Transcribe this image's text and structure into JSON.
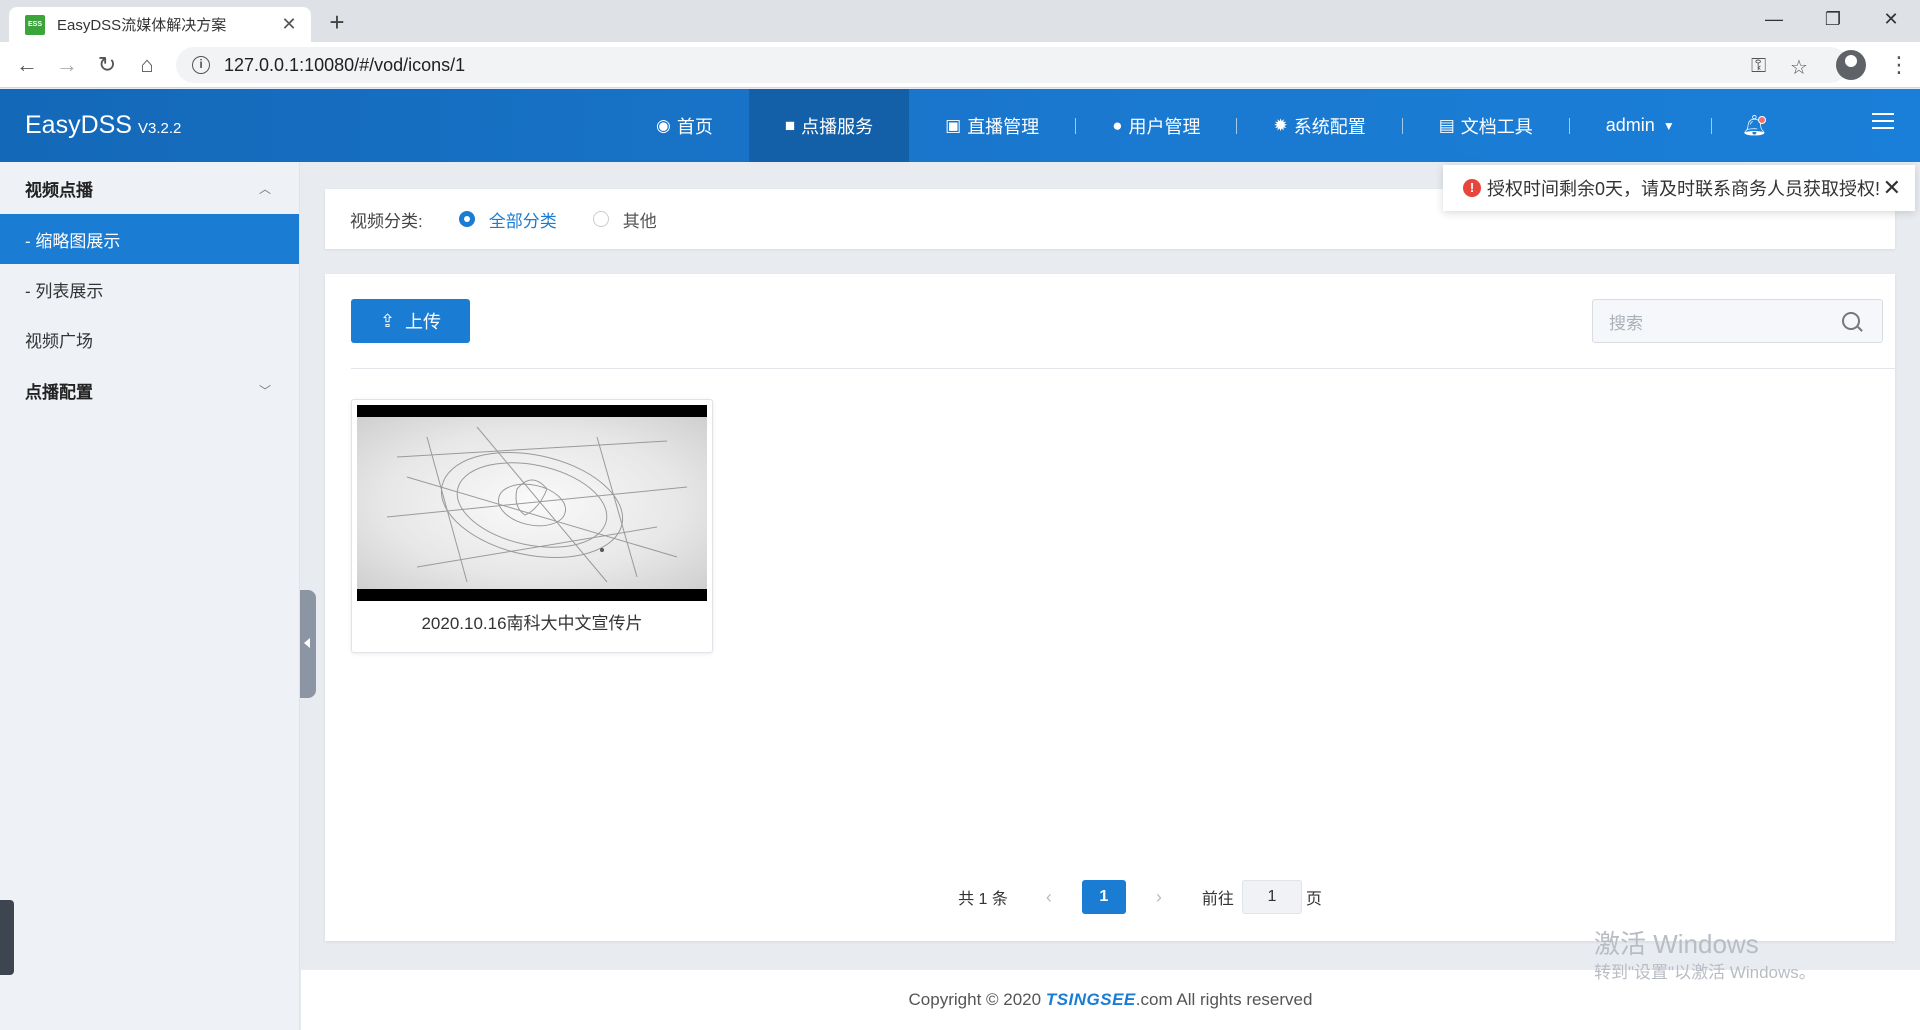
{
  "browser": {
    "tab_title": "EasyDSS流媒体解决方案",
    "favicon_text": "ESS",
    "url": "127.0.0.1:10080/#/vod/icons/1"
  },
  "header": {
    "brand": "EasyDSS",
    "version": "V3.2.2",
    "nav": [
      {
        "label": "首页",
        "icon": "dashboard-icon"
      },
      {
        "label": "点播服务",
        "icon": "video-camera-icon"
      },
      {
        "label": "直播管理",
        "icon": "live-icon"
      },
      {
        "label": "用户管理",
        "icon": "user-icon"
      },
      {
        "label": "系统配置",
        "icon": "gear-icon"
      },
      {
        "label": "文档工具",
        "icon": "document-icon"
      }
    ],
    "user": "admin"
  },
  "toast": {
    "message": "授权时间剩余0天，请及时联系商务人员获取授权!"
  },
  "sidebar": {
    "group1": "视频点播",
    "items": [
      "- 缩略图展示",
      "- 列表展示",
      "视频广场"
    ],
    "group2": "点播配置"
  },
  "filter": {
    "label": "视频分类:",
    "options": [
      "全部分类",
      "其他"
    ],
    "selected": "全部分类"
  },
  "toolbar": {
    "upload_label": "上传",
    "search_placeholder": "搜索"
  },
  "videos": [
    {
      "title": "2020.10.16南科大中文宣传片"
    }
  ],
  "pagination": {
    "total": "共 1 条",
    "current": "1",
    "goto_label": "前往",
    "goto_value": "1",
    "page_suffix": "页"
  },
  "footer": {
    "prefix": "Copyright © 2020 ",
    "logo": "TSINGSEE",
    "suffix": ".com All rights reserved"
  },
  "watermark": {
    "title": "激活 Windows",
    "sub": "转到\"设置\"以激活 Windows。"
  }
}
